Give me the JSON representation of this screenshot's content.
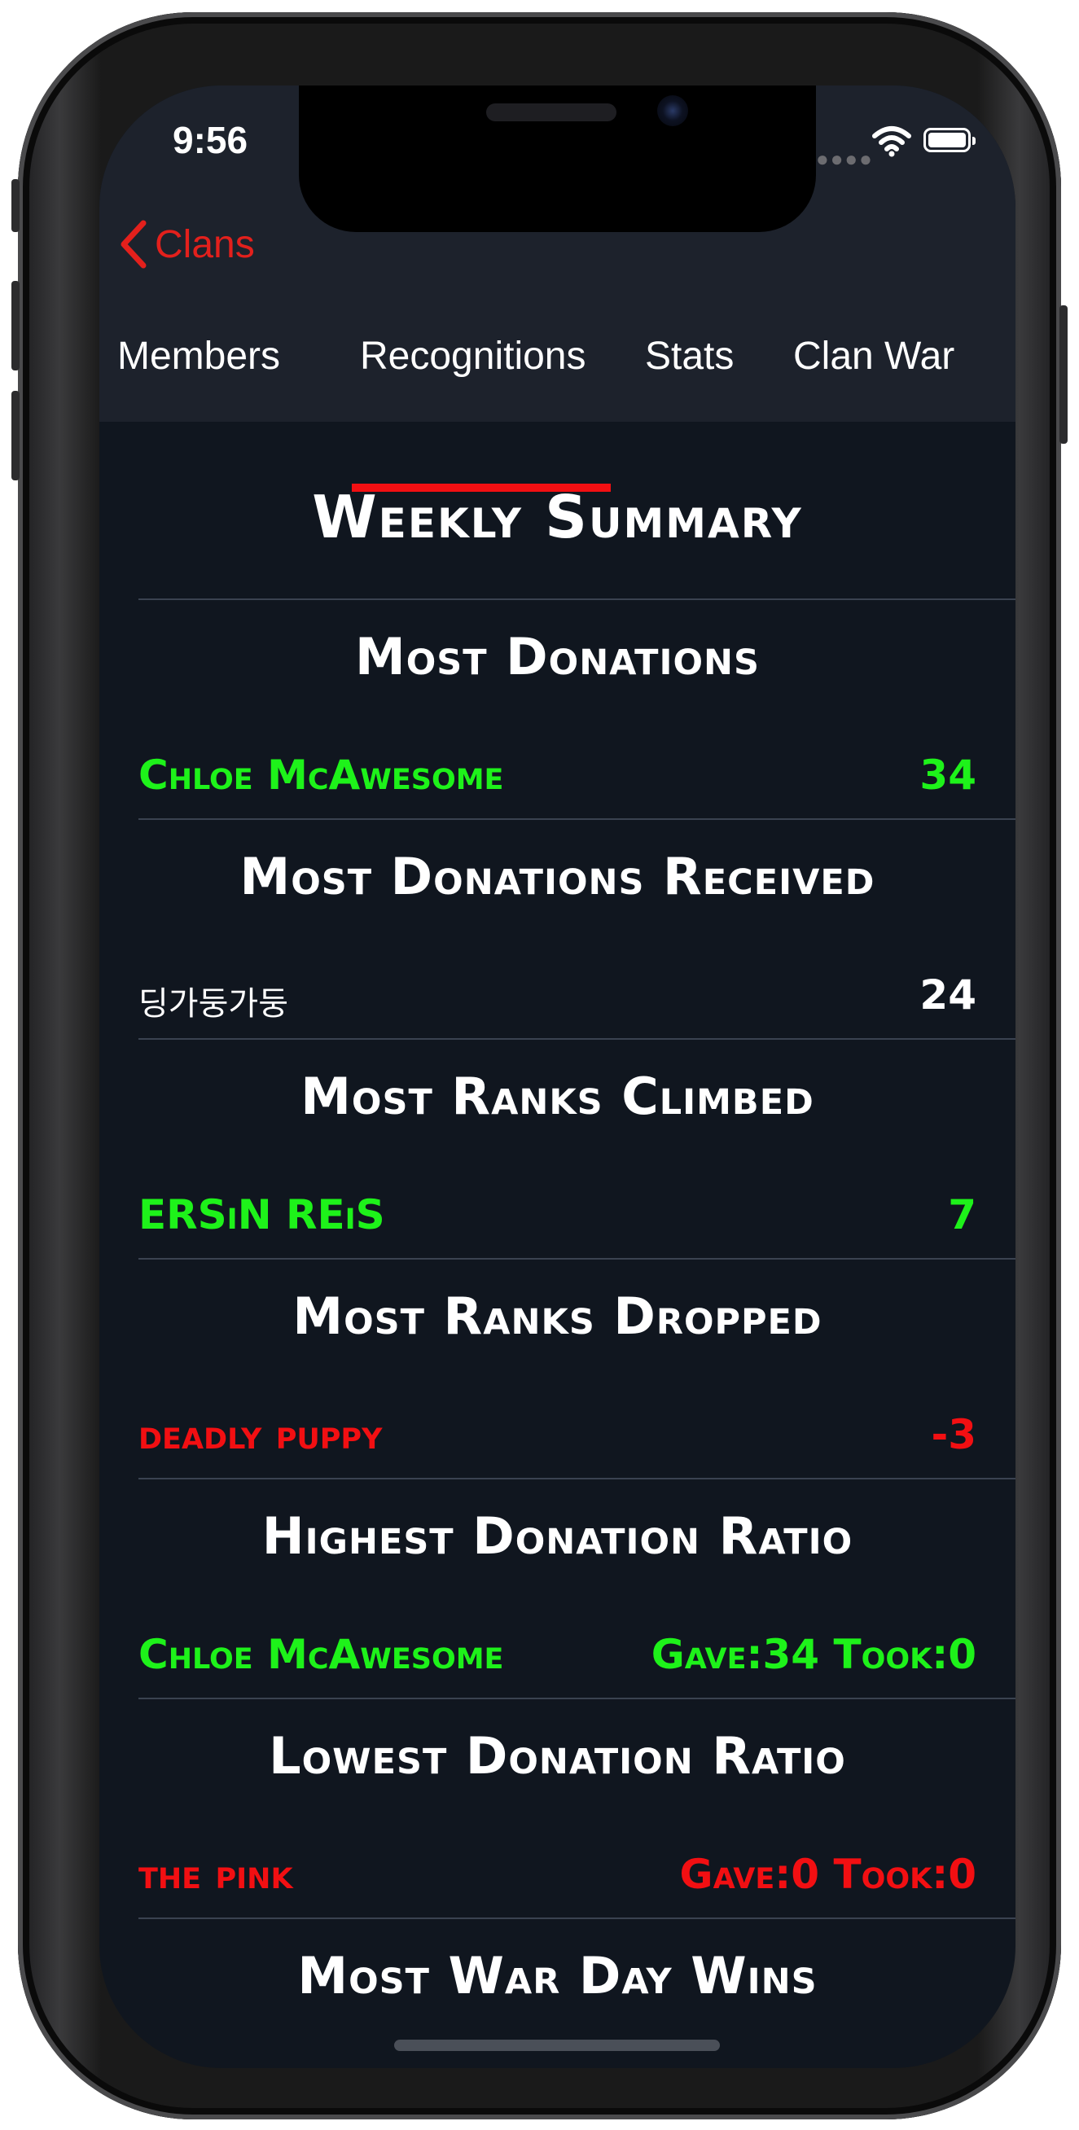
{
  "status_bar": {
    "time": "9:56"
  },
  "nav": {
    "back_label": "Clans"
  },
  "tabs": [
    {
      "label": "Members"
    },
    {
      "label": "Recognitions",
      "selected": true
    },
    {
      "label": "Stats"
    },
    {
      "label": "Clan War"
    }
  ],
  "content": {
    "title": "Weekly Summary",
    "sections": [
      {
        "title": "Most Donations",
        "name": "Chloe McAwesome",
        "value": "34",
        "color": "#1ef21a"
      },
      {
        "title": "Most Donations Received",
        "name": "딩가둥가둥",
        "value": "24",
        "color": "#ffffff"
      },
      {
        "title": "Most Ranks Climbed",
        "name": "ERSiN REiS",
        "value": "7",
        "color": "#1ef21a"
      },
      {
        "title": "Most Ranks Dropped",
        "name": "deadly puppy",
        "value": "-3",
        "color": "#f20f12"
      },
      {
        "title": "Highest Donation Ratio",
        "name": "Chloe McAwesome",
        "value": "Gave:34 Took:0",
        "color": "#1ef21a"
      },
      {
        "title": "Lowest Donation Ratio",
        "name": "the pink",
        "value": "Gave:0 Took:0",
        "color": "#f20f12"
      },
      {
        "title": "Most War Day Wins"
      }
    ]
  },
  "colors": {
    "accent": "#f20f12",
    "positive": "#1ef21a",
    "background": "#10161f",
    "bar": "#1d222c"
  }
}
